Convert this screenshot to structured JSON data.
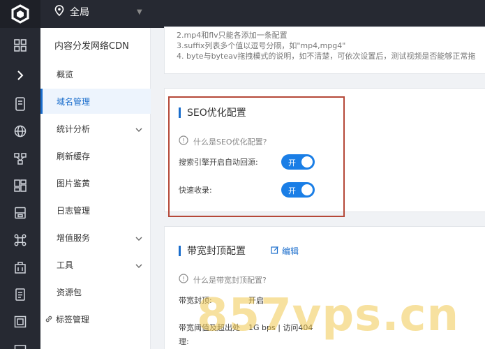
{
  "topbar": {
    "region_label": "全局",
    "logo_icon": "cube-logo-icon",
    "region_icon": "location-pin-icon"
  },
  "rail": {
    "icons": [
      "grid-icon",
      "chevron-right-icon",
      "server-icon",
      "globe-icon",
      "network-icon",
      "dashboard-icon",
      "database-icon",
      "cluster-icon",
      "building-icon",
      "document-icon",
      "image-icon",
      "more-icon"
    ]
  },
  "sidebar": {
    "title": "内容分发网络CDN",
    "items": [
      {
        "label": "概览"
      },
      {
        "label": "域名管理",
        "active": true
      },
      {
        "label": "统计分析",
        "expandable": true
      },
      {
        "label": "刷新缓存"
      },
      {
        "label": "图片鉴黄"
      },
      {
        "label": "日志管理"
      },
      {
        "label": "增值服务",
        "expandable": true
      },
      {
        "label": "工具",
        "expandable": true
      },
      {
        "label": "资源包"
      },
      {
        "label": "标签管理",
        "icon": "link-icon"
      }
    ]
  },
  "notes": {
    "lines": [
      "2.mp4和flv只能各添加一条配置",
      "3.suffix列表多个值以逗号分隔，如\"mp4,mpg4\"",
      "4. byte与byteav拖拽模式的说明，如不清楚，可依次设置后，测试视频是否能够正常拖"
    ]
  },
  "seo": {
    "title": "SEO优化配置",
    "help": "什么是SEO优化配置?",
    "rows": [
      {
        "label": "搜索引擎开启自动回源:",
        "toggle": "开"
      },
      {
        "label": "快速收录:",
        "toggle": "开"
      }
    ]
  },
  "bandwidth": {
    "title": "带宽封顶配置",
    "edit": "编辑",
    "help": "什么是带宽封顶配置?",
    "cap_label": "带宽封顶:",
    "cap_value": "开启",
    "threshold_label_1": "带宽阈值及超出处",
    "threshold_label_2": "理:",
    "threshold_value": "1G bps | 访问404"
  },
  "watermark": "857vps.cn",
  "colors": {
    "accent": "#1a6dcc",
    "toggle": "#1a7ee6",
    "highlight": "#b54838",
    "dark_nav": "#262932"
  }
}
